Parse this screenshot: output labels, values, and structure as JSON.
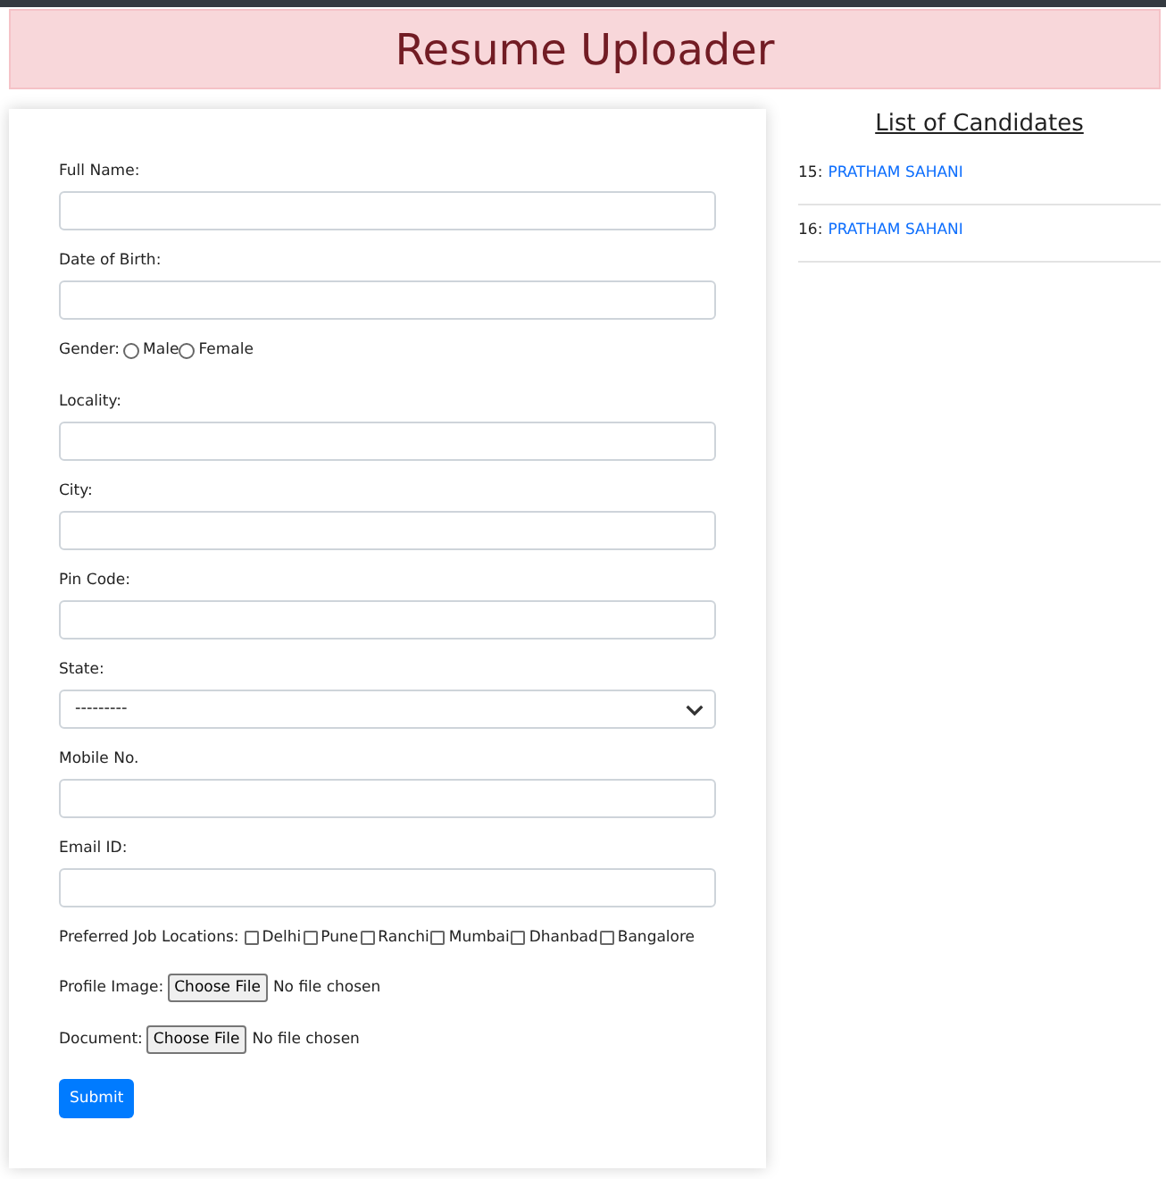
{
  "header": {
    "title": "Resume Uploader"
  },
  "form": {
    "fields": [
      {
        "kind": "text",
        "label": "Full Name:"
      },
      {
        "kind": "text",
        "label": "Date of Birth:"
      },
      {
        "kind": "radio",
        "label": "Gender:",
        "options": [
          {
            "label": "Male",
            "checked": false
          },
          {
            "label": "Female",
            "checked": false
          }
        ]
      },
      {
        "kind": "text",
        "label": "Locality:"
      },
      {
        "kind": "text",
        "label": "City:"
      },
      {
        "kind": "text",
        "label": "Pin Code:"
      },
      {
        "kind": "select",
        "label": "State:",
        "value": "---------"
      },
      {
        "kind": "text",
        "label": "Mobile No."
      },
      {
        "kind": "text",
        "label": "Email ID:"
      },
      {
        "kind": "checkbox",
        "label": "Preferred Job Locations:",
        "options": [
          {
            "label": "Delhi",
            "checked": false
          },
          {
            "label": "Pune",
            "checked": false
          },
          {
            "label": "Ranchi",
            "checked": false
          },
          {
            "label": "Mumbai",
            "checked": false
          },
          {
            "label": "Dhanbad",
            "checked": false
          },
          {
            "label": "Bangalore",
            "checked": false
          }
        ]
      },
      {
        "kind": "file",
        "label": "Profile Image:",
        "button": "Choose File",
        "status": "No file chosen"
      },
      {
        "kind": "file",
        "label": "Document:",
        "button": "Choose File",
        "status": "No file chosen"
      }
    ],
    "submit": "Submit"
  },
  "candidates": {
    "title": "List of Candidates",
    "items": [
      {
        "number": "15:",
        "name": "PRATHAM SAHANI"
      },
      {
        "number": "16:",
        "name": "PRATHAM SAHANI"
      }
    ]
  }
}
